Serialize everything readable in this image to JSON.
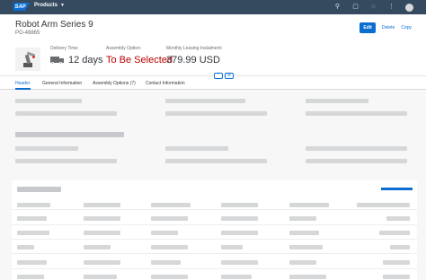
{
  "shell": {
    "logo_text": "SAP",
    "product_label": "Products",
    "icons": [
      "search-icon",
      "notifications-icon",
      "help-icon",
      "grid-icon",
      "avatar"
    ]
  },
  "header": {
    "title": "Robot Arm Series 9",
    "subtitle": "PO-48865",
    "actions": {
      "edit": "Edit",
      "delete": "Delete",
      "copy": "Copy"
    },
    "kpis": [
      {
        "label": "Delivery Time:",
        "value": "12 days",
        "icon": "truck-icon"
      },
      {
        "label": "Assembly Option:",
        "value": "To Be Selected"
      },
      {
        "label": "Monthly Leasing Instalment:",
        "value": "379.99 USD"
      }
    ]
  },
  "tabs": [
    {
      "label": "Header",
      "active": true
    },
    {
      "label": "General Information",
      "active": false
    },
    {
      "label": "Assembly Options (7)",
      "active": false
    },
    {
      "label": "Contact Information",
      "active": false
    }
  ],
  "colors": {
    "shell": "#354a5f",
    "accent": "#0a6ed1",
    "negative": "#bb0000",
    "placeholder": "#d5d7d9"
  }
}
